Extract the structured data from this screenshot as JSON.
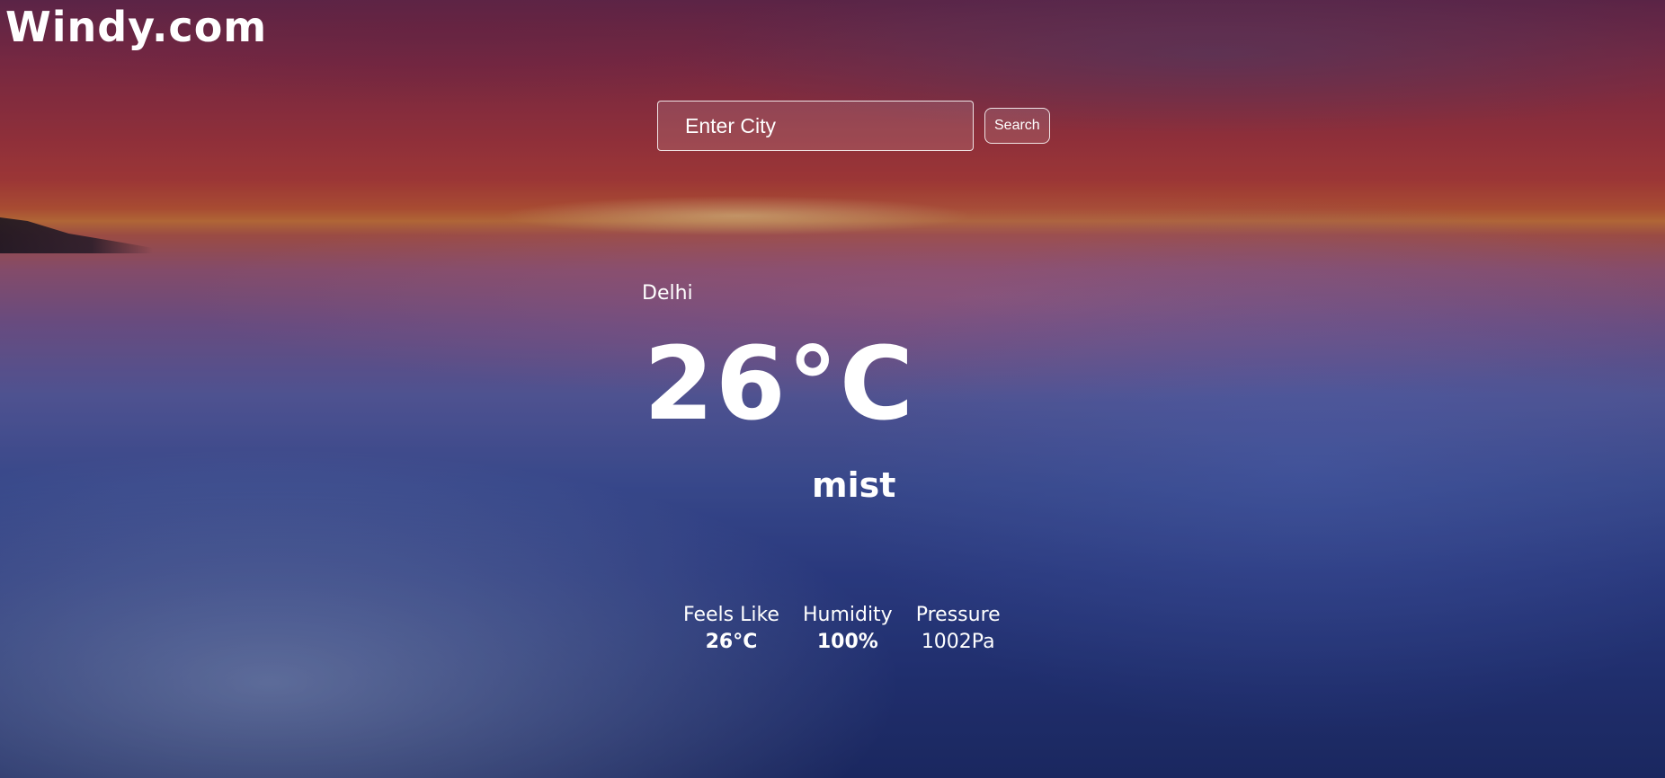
{
  "header": {
    "brand": "Windy.com"
  },
  "search": {
    "placeholder": "Enter City",
    "value": "",
    "button_label": "Search"
  },
  "weather": {
    "city": "Delhi",
    "temperature": "26°C",
    "condition": "mist"
  },
  "details": [
    {
      "label": "Feels Like",
      "value": "26°C"
    },
    {
      "label": "Humidity",
      "value": "100%"
    },
    {
      "label": "Pressure",
      "value": "1002Pa"
    }
  ]
}
